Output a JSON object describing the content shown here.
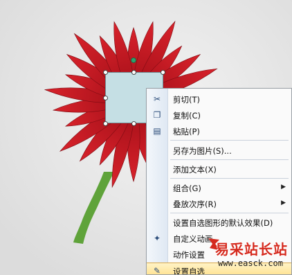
{
  "photo": {
    "subject": "red gerbera flower"
  },
  "menu": {
    "items": [
      {
        "label": "剪切(T)",
        "icon": "cut-icon"
      },
      {
        "label": "复制(C)",
        "icon": "copy-icon"
      },
      {
        "label": "粘贴(P)",
        "icon": "paste-icon"
      },
      {
        "label": "另存为图片(S)...",
        "icon": ""
      },
      {
        "label": "添加文本(X)",
        "icon": ""
      },
      {
        "label": "组合(G)",
        "icon": "",
        "submenu": true
      },
      {
        "label": "叠放次序(R)",
        "icon": "",
        "submenu": true
      },
      {
        "label": "设置自选图形的默认效果(D)",
        "icon": ""
      },
      {
        "label": "自定义动画",
        "icon": "custom-animation-icon"
      },
      {
        "label": "动作设置",
        "icon": ""
      },
      {
        "label": "设置自选",
        "icon": "format-shape-icon"
      }
    ]
  },
  "watermark": {
    "text": "易采站长站",
    "url": "www.easck.com"
  },
  "colors": {
    "petal": "#c3151f",
    "shape_fill": "#c5dfe4",
    "highlight": "#ffe08a",
    "watermark_red": "#d52a1e"
  }
}
